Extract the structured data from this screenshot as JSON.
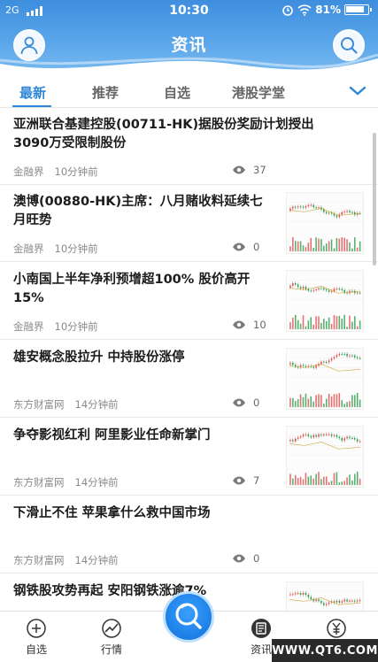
{
  "status_bar": {
    "network": "2G",
    "time": "10:30",
    "battery": "81%"
  },
  "header": {
    "title": "资讯",
    "profile_icon": "user-icon",
    "search_icon": "search-icon"
  },
  "tabs": [
    {
      "label": "最新",
      "active": true
    },
    {
      "label": "推荐",
      "active": false
    },
    {
      "label": "自选",
      "active": false
    },
    {
      "label": "港股学堂",
      "active": false
    }
  ],
  "news": [
    {
      "title_line1": "亚洲联合基建控股(00711-HK)据股份奖励计划授出",
      "title_line2": "3090万受限制股份",
      "source": "金融界",
      "time": "10分钟前",
      "views": "37",
      "has_thumb": false
    },
    {
      "title_line1": "澳博(00880-HK)主席：八月赌收料延续七",
      "title_line2": "月旺势",
      "source": "金融界",
      "time": "10分钟前",
      "views": "0",
      "has_thumb": true
    },
    {
      "title_line1": "小南国上半年净利预增超100% 股价高开",
      "title_line2": "15%",
      "source": "金融界",
      "time": "10分钟前",
      "views": "10",
      "has_thumb": true
    },
    {
      "title_line1": "雄安概念股拉升 中持股份涨停",
      "title_line2": "",
      "source": "东方财富网",
      "time": "14分钟前",
      "views": "0",
      "has_thumb": true
    },
    {
      "title_line1": "争夺影视红利 阿里影业任命新掌门",
      "title_line2": "",
      "source": "东方财富网",
      "time": "14分钟前",
      "views": "7",
      "has_thumb": true
    },
    {
      "title_line1": "下滑止不住 苹果拿什么救中国市场",
      "title_line2": "",
      "source": "东方财富网",
      "time": "14分钟前",
      "views": "0",
      "has_thumb": false
    },
    {
      "title_line1": "钢铁股攻势再起 安阳钢铁涨逾7%",
      "title_line2": "",
      "source": "",
      "time": "",
      "views": "",
      "has_thumb": true
    }
  ],
  "bottom_nav": [
    {
      "label": "自选",
      "icon": "plus-circle-icon"
    },
    {
      "label": "行情",
      "icon": "trend-icon"
    },
    {
      "label": "",
      "icon": "search-center-icon"
    },
    {
      "label": "资讯",
      "icon": "news-icon"
    },
    {
      "label": "",
      "icon": "yen-icon"
    }
  ],
  "watermark": "WWW.QT6.COM",
  "colors": {
    "accent": "#2f86d6",
    "header": "#4a99e3"
  }
}
